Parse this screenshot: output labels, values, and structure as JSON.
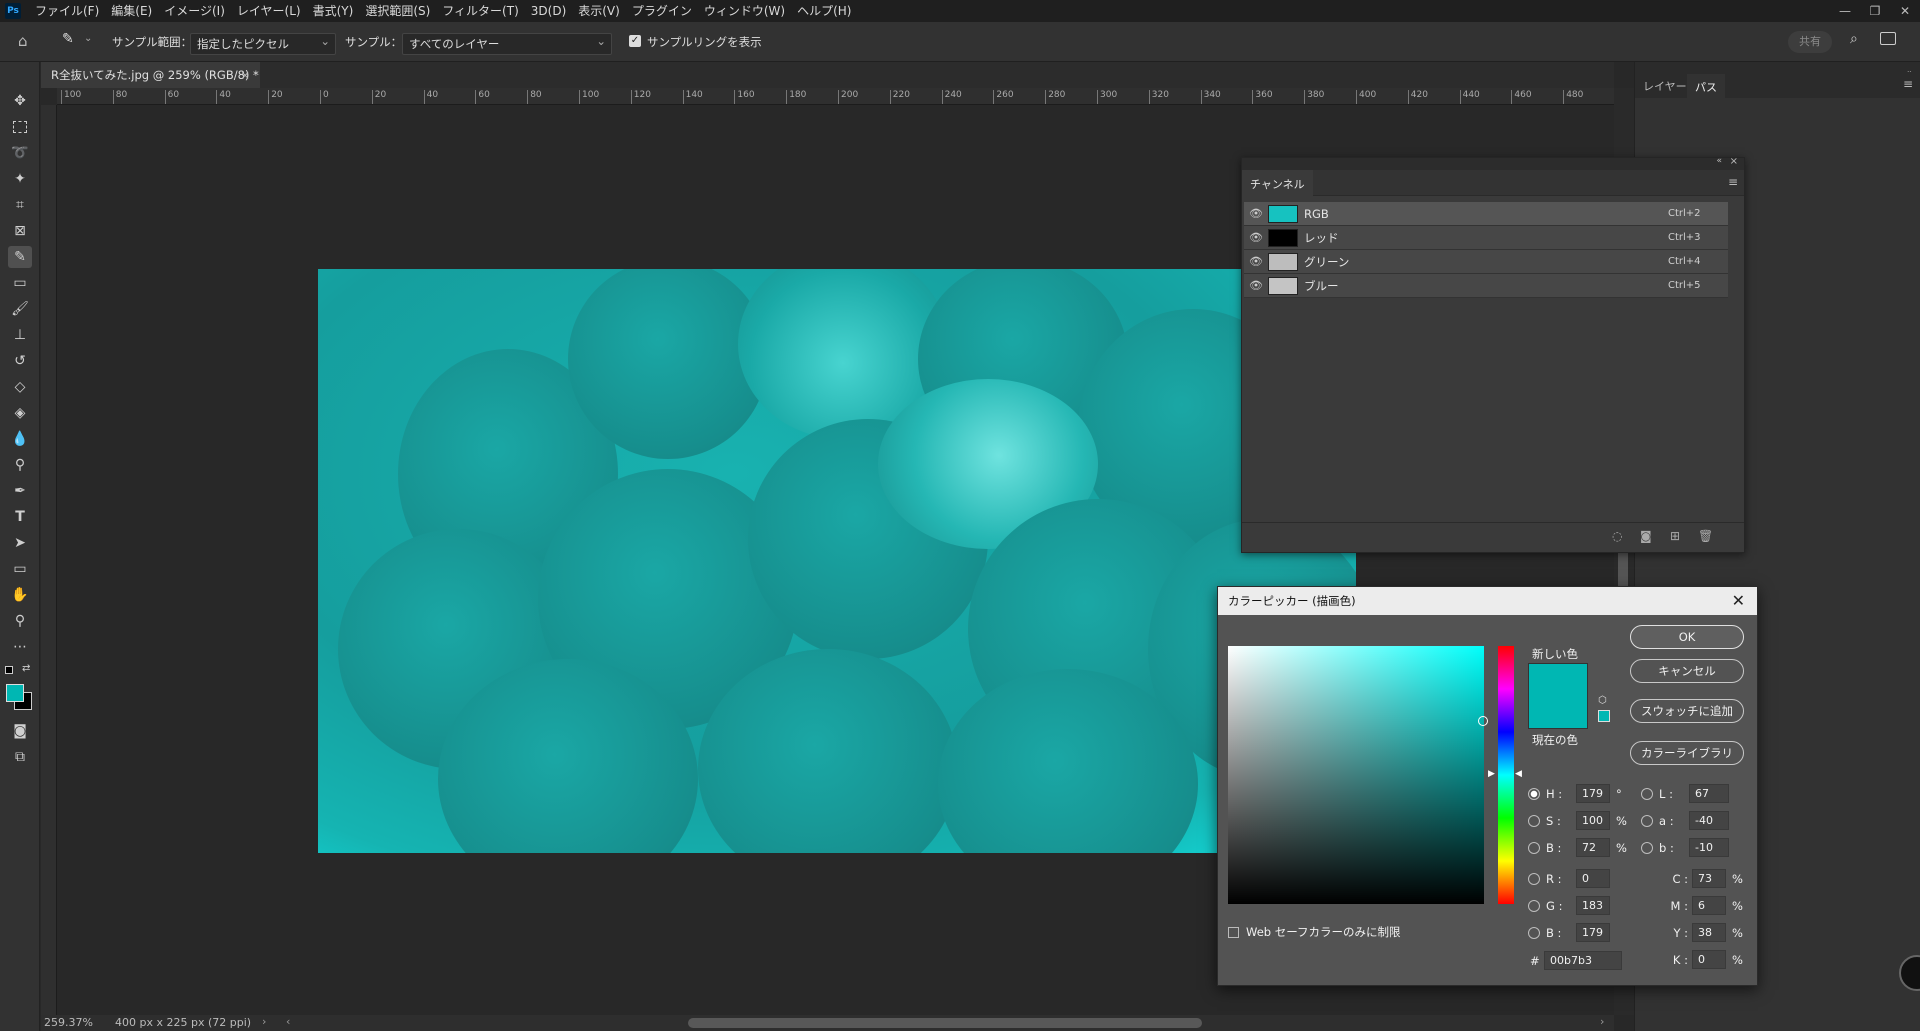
{
  "menubar": {
    "logo": "Ps",
    "items": [
      "ファイル(F)",
      "編集(E)",
      "イメージ(I)",
      "レイヤー(L)",
      "書式(Y)",
      "選択範囲(S)",
      "フィルター(T)",
      "3D(D)",
      "表示(V)",
      "プラグイン",
      "ウィンドウ(W)",
      "ヘルプ(H)"
    ]
  },
  "options": {
    "sample_size_label": "サンプル範囲：",
    "sample_size_value": "指定したピクセル",
    "sample_label": "サンプル：",
    "sample_value": "すべてのレイヤー",
    "show_ring_label": "サンプルリングを表示",
    "share_label": "共有"
  },
  "document": {
    "tab_title": "R全抜いてみた.jpg @ 259% (RGB/8) *",
    "ruler_ticks": [
      "100",
      "80",
      "60",
      "40",
      "20",
      "0",
      "20",
      "40",
      "60",
      "80",
      "100",
      "120",
      "140",
      "160",
      "180",
      "200",
      "220",
      "240",
      "260",
      "280",
      "300",
      "320",
      "340",
      "360",
      "380",
      "400",
      "420",
      "440",
      "460",
      "480"
    ]
  },
  "status": {
    "zoom": "259.37%",
    "size": "400 px x 225 px (72 ppi)"
  },
  "right_panel": {
    "tabs": [
      "レイヤー",
      "パス"
    ]
  },
  "channels": {
    "title": "チャンネル",
    "rows": [
      {
        "name": "RGB",
        "shortcut": "Ctrl+2",
        "thumb": "#16c2c0"
      },
      {
        "name": "レッド",
        "shortcut": "Ctrl+3",
        "thumb": "#000000"
      },
      {
        "name": "グリーン",
        "shortcut": "Ctrl+4",
        "thumb": "#bdbdbd"
      },
      {
        "name": "ブルー",
        "shortcut": "Ctrl+5",
        "thumb": "#c4c4c4"
      }
    ]
  },
  "picker": {
    "title": "カラーピッカー (描画色)",
    "new_label": "新しい色",
    "current_label": "現在の色",
    "buttons": {
      "ok": "OK",
      "cancel": "キャンセル",
      "add_swatch": "スウォッチに追加",
      "libraries": "カラーライブラリ"
    },
    "web_only": "Web セーフカラーのみに制限",
    "fields": {
      "H": "179",
      "S": "100",
      "B": "72",
      "R": "0",
      "G": "183",
      "Bv": "179",
      "L": "67",
      "a": "-40",
      "b": "-10",
      "C": "73",
      "M": "6",
      "Y": "38",
      "K": "0",
      "hex": "00b7b3"
    },
    "labels": {
      "H": "H :",
      "S": "S :",
      "B": "B :",
      "R": "R :",
      "G": "G :",
      "Bv": "B :",
      "L": "L :",
      "a": "a :",
      "b": "b :",
      "C": "C :",
      "M": "M :",
      "Y": "Y :",
      "K": "K :",
      "hash": "#",
      "deg": "°",
      "pct": "%"
    },
    "color": "#00b7b3"
  }
}
